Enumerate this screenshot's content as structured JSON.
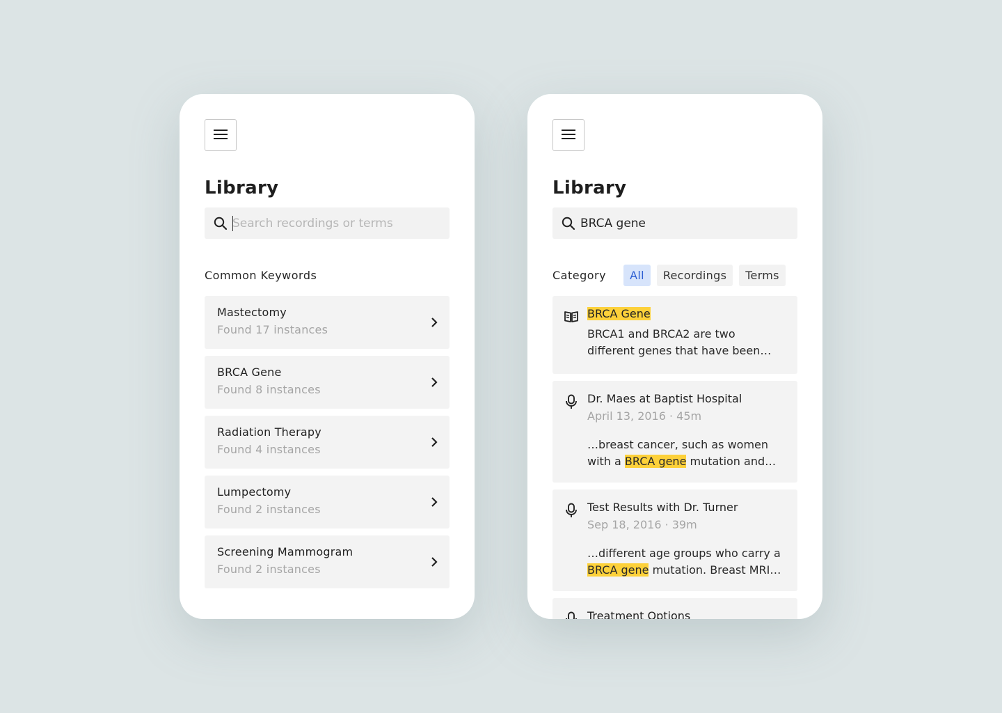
{
  "left": {
    "title": "Library",
    "search": {
      "placeholder": "Search recordings or terms",
      "value": ""
    },
    "section_label": "Common Keywords",
    "keywords": [
      {
        "name": "Mastectomy",
        "count": "Found 17 instances"
      },
      {
        "name": "BRCA Gene",
        "count": "Found 8 instances"
      },
      {
        "name": "Radiation Therapy",
        "count": "Found 4 instances"
      },
      {
        "name": "Lumpectomy",
        "count": "Found 2 instances"
      },
      {
        "name": "Screening Mammogram",
        "count": "Found 2 instances"
      }
    ]
  },
  "right": {
    "title": "Library",
    "search": {
      "value": "BRCA gene"
    },
    "category_label": "Category",
    "chips": [
      {
        "label": "All",
        "active": true
      },
      {
        "label": "Recordings",
        "active": false
      },
      {
        "label": "Terms",
        "active": false
      }
    ],
    "results": [
      {
        "type": "term",
        "icon": "book-icon",
        "title": "BRCA Gene",
        "snippet": "BRCA1 and BRCA2 are two different genes that have been…"
      },
      {
        "type": "recording",
        "icon": "microphone-icon",
        "title": "Dr. Maes at Baptist Hospital",
        "meta": "April 13, 2016 · 45m",
        "snippet_before": "…breast cancer, such as women with a ",
        "snippet_highlight": "BRCA gene",
        "snippet_after": " mutation and…"
      },
      {
        "type": "recording",
        "icon": "microphone-icon",
        "title": "Test Results with Dr. Turner",
        "meta": "Sep 18, 2016 · 39m",
        "snippet_before": "…different age groups who carry a ",
        "snippet_highlight": "BRCA gene",
        "snippet_after": " mutation. Breast MRI…"
      },
      {
        "type": "recording",
        "icon": "microphone-icon",
        "title": "Treatment Options"
      }
    ]
  },
  "colors": {
    "background": "#dce4e5",
    "card": "#ffffff",
    "item": "#f3f3f3",
    "highlight": "#fdd13a",
    "chip_active_bg": "#d7e4fb",
    "chip_active_text": "#2d5fd3"
  }
}
